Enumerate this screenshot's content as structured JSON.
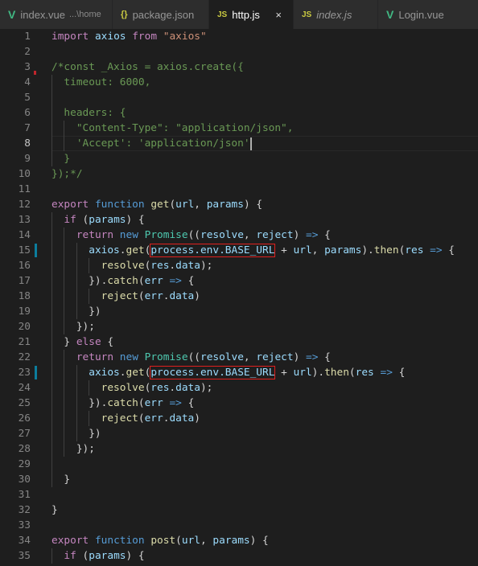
{
  "tabs": [
    {
      "icon": "vue-icon",
      "glyph": "V",
      "label": "index.vue",
      "desc": "...\\home",
      "active": false,
      "italic": false
    },
    {
      "icon": "json-icon",
      "glyph": "{}",
      "label": "package.json",
      "active": false,
      "italic": false
    },
    {
      "icon": "js-icon",
      "glyph": "JS",
      "label": "http.js",
      "active": true,
      "italic": false,
      "close": "×"
    },
    {
      "icon": "js-icon",
      "glyph": "JS",
      "label": "index.js",
      "active": false,
      "italic": true
    },
    {
      "icon": "vue-icon",
      "glyph": "V",
      "label": "Login.vue",
      "active": false,
      "italic": false
    }
  ],
  "editor": {
    "current_line": 8,
    "modified_lines": [
      15,
      23
    ],
    "colors": {
      "keyword": "#c586c0",
      "storage": "#569cd6",
      "string": "#ce9178",
      "comment": "#6a9955",
      "function": "#dcdcaa",
      "variable": "#9cdcfe",
      "class": "#4ec9b0",
      "highlight_box": "#e0201e"
    },
    "lines": [
      [
        [
          "kw",
          "import"
        ],
        [
          "pun",
          " "
        ],
        [
          "var",
          "axios"
        ],
        [
          "pun",
          " "
        ],
        [
          "kw",
          "from"
        ],
        [
          "pun",
          " "
        ],
        [
          "str",
          "\"axios\""
        ]
      ],
      [],
      [
        [
          "com",
          "/*const _Axios = axios.create({"
        ]
      ],
      [
        [
          "com",
          "  timeout: 6000,"
        ]
      ],
      [],
      [
        [
          "com",
          "  headers: {"
        ]
      ],
      [
        [
          "com",
          "    \"Content-Type\": \"application/json\","
        ]
      ],
      [
        [
          "com",
          "    'Accept': 'application/json'"
        ],
        [
          "cursor",
          ""
        ]
      ],
      [
        [
          "com",
          "  }"
        ]
      ],
      [
        [
          "com",
          "});*/"
        ]
      ],
      [],
      [
        [
          "kw",
          "export"
        ],
        [
          "pun",
          " "
        ],
        [
          "bk",
          "function"
        ],
        [
          "pun",
          " "
        ],
        [
          "fn",
          "get"
        ],
        [
          "pun",
          "("
        ],
        [
          "var",
          "url"
        ],
        [
          "pun",
          ", "
        ],
        [
          "var",
          "params"
        ],
        [
          "pun",
          ") {"
        ]
      ],
      [
        [
          "pun",
          "  "
        ],
        [
          "kw",
          "if"
        ],
        [
          "pun",
          " ("
        ],
        [
          "var",
          "params"
        ],
        [
          "pun",
          ") {"
        ]
      ],
      [
        [
          "pun",
          "    "
        ],
        [
          "kw",
          "return"
        ],
        [
          "pun",
          " "
        ],
        [
          "bk",
          "new"
        ],
        [
          "pun",
          " "
        ],
        [
          "cls",
          "Promise"
        ],
        [
          "pun",
          "(("
        ],
        [
          "var",
          "resolve"
        ],
        [
          "pun",
          ", "
        ],
        [
          "var",
          "reject"
        ],
        [
          "pun",
          ") "
        ],
        [
          "bk",
          "=>"
        ],
        [
          "pun",
          " {"
        ]
      ],
      [
        [
          "pun",
          "      "
        ],
        [
          "var",
          "axios"
        ],
        [
          "pun",
          "."
        ],
        [
          "fn",
          "get"
        ],
        [
          "pun",
          "("
        ],
        [
          "box",
          "process.env.BASE_URL"
        ],
        [
          "pun",
          " + "
        ],
        [
          "var",
          "url"
        ],
        [
          "pun",
          ", "
        ],
        [
          "var",
          "params"
        ],
        [
          "pun",
          ")."
        ],
        [
          "fn",
          "then"
        ],
        [
          "pun",
          "("
        ],
        [
          "var",
          "res"
        ],
        [
          "pun",
          " "
        ],
        [
          "bk",
          "=>"
        ],
        [
          "pun",
          " {"
        ]
      ],
      [
        [
          "pun",
          "        "
        ],
        [
          "fn",
          "resolve"
        ],
        [
          "pun",
          "("
        ],
        [
          "var",
          "res"
        ],
        [
          "pun",
          "."
        ],
        [
          "var",
          "data"
        ],
        [
          "pun",
          ");"
        ]
      ],
      [
        [
          "pun",
          "      })."
        ],
        [
          "fn",
          "catch"
        ],
        [
          "pun",
          "("
        ],
        [
          "var",
          "err"
        ],
        [
          "pun",
          " "
        ],
        [
          "bk",
          "=>"
        ],
        [
          "pun",
          " {"
        ]
      ],
      [
        [
          "pun",
          "        "
        ],
        [
          "fn",
          "reject"
        ],
        [
          "pun",
          "("
        ],
        [
          "var",
          "err"
        ],
        [
          "pun",
          "."
        ],
        [
          "var",
          "data"
        ],
        [
          "pun",
          ")"
        ]
      ],
      [
        [
          "pun",
          "      })"
        ]
      ],
      [
        [
          "pun",
          "    });"
        ]
      ],
      [
        [
          "pun",
          "  } "
        ],
        [
          "kw",
          "else"
        ],
        [
          "pun",
          " {"
        ]
      ],
      [
        [
          "pun",
          "    "
        ],
        [
          "kw",
          "return"
        ],
        [
          "pun",
          " "
        ],
        [
          "bk",
          "new"
        ],
        [
          "pun",
          " "
        ],
        [
          "cls",
          "Promise"
        ],
        [
          "pun",
          "(("
        ],
        [
          "var",
          "resolve"
        ],
        [
          "pun",
          ", "
        ],
        [
          "var",
          "reject"
        ],
        [
          "pun",
          ") "
        ],
        [
          "bk",
          "=>"
        ],
        [
          "pun",
          " {"
        ]
      ],
      [
        [
          "pun",
          "      "
        ],
        [
          "var",
          "axios"
        ],
        [
          "pun",
          "."
        ],
        [
          "fn",
          "get"
        ],
        [
          "pun",
          "("
        ],
        [
          "box",
          "process.env.BASE_URL"
        ],
        [
          "pun",
          " + "
        ],
        [
          "var",
          "url"
        ],
        [
          "pun",
          ")."
        ],
        [
          "fn",
          "then"
        ],
        [
          "pun",
          "("
        ],
        [
          "var",
          "res"
        ],
        [
          "pun",
          " "
        ],
        [
          "bk",
          "=>"
        ],
        [
          "pun",
          " {"
        ]
      ],
      [
        [
          "pun",
          "        "
        ],
        [
          "fn",
          "resolve"
        ],
        [
          "pun",
          "("
        ],
        [
          "var",
          "res"
        ],
        [
          "pun",
          "."
        ],
        [
          "var",
          "data"
        ],
        [
          "pun",
          ");"
        ]
      ],
      [
        [
          "pun",
          "      })."
        ],
        [
          "fn",
          "catch"
        ],
        [
          "pun",
          "("
        ],
        [
          "var",
          "err"
        ],
        [
          "pun",
          " "
        ],
        [
          "bk",
          "=>"
        ],
        [
          "pun",
          " {"
        ]
      ],
      [
        [
          "pun",
          "        "
        ],
        [
          "fn",
          "reject"
        ],
        [
          "pun",
          "("
        ],
        [
          "var",
          "err"
        ],
        [
          "pun",
          "."
        ],
        [
          "var",
          "data"
        ],
        [
          "pun",
          ")"
        ]
      ],
      [
        [
          "pun",
          "      })"
        ]
      ],
      [
        [
          "pun",
          "    });"
        ]
      ],
      [],
      [
        [
          "pun",
          "  }"
        ]
      ],
      [],
      [
        [
          "pun",
          "}"
        ]
      ],
      [],
      [
        [
          "kw",
          "export"
        ],
        [
          "pun",
          " "
        ],
        [
          "bk",
          "function"
        ],
        [
          "pun",
          " "
        ],
        [
          "fn",
          "post"
        ],
        [
          "pun",
          "("
        ],
        [
          "var",
          "url"
        ],
        [
          "pun",
          ", "
        ],
        [
          "var",
          "params"
        ],
        [
          "pun",
          ") {"
        ]
      ],
      [
        [
          "pun",
          "  "
        ],
        [
          "kw",
          "if"
        ],
        [
          "pun",
          " ("
        ],
        [
          "var",
          "params"
        ],
        [
          "pun",
          ") {"
        ]
      ]
    ]
  }
}
